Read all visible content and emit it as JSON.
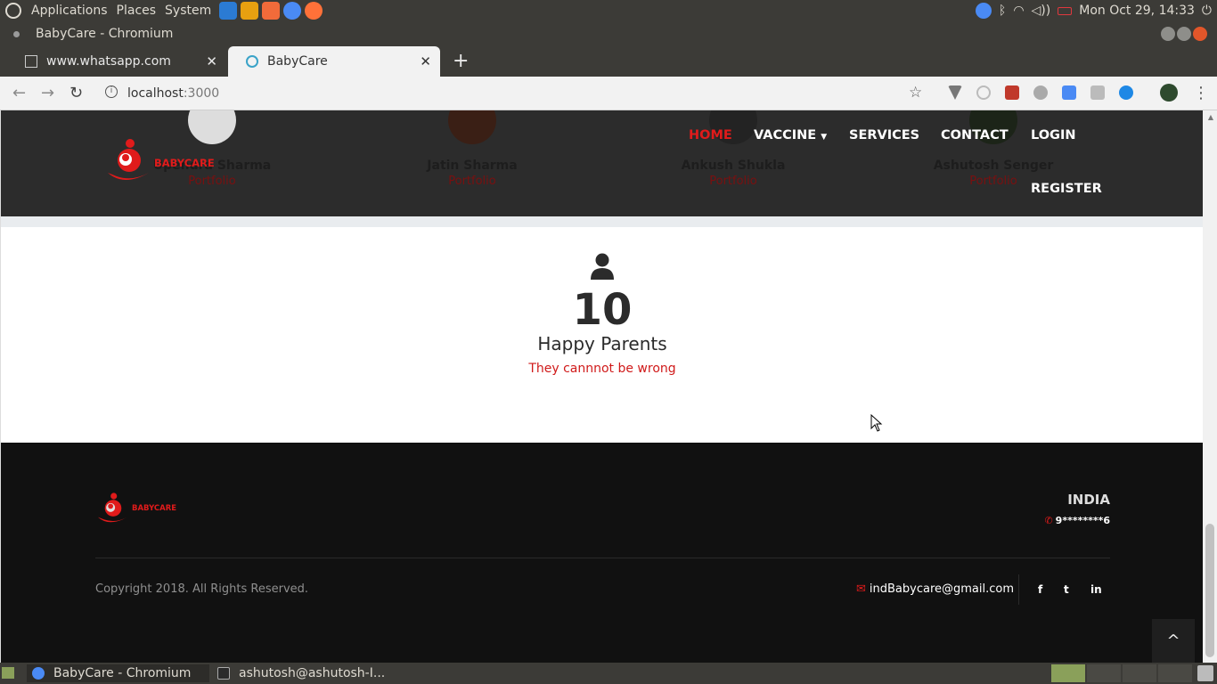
{
  "topbar": {
    "menus": [
      "Applications",
      "Places",
      "System"
    ],
    "clock": "Mon Oct 29, 14:33"
  },
  "window": {
    "title": "BabyCare - Chromium"
  },
  "tabs": [
    {
      "label": "www.whatsapp.com"
    },
    {
      "label": "BabyCare"
    }
  ],
  "omnibox": {
    "host": "localhost",
    "port": ":3000"
  },
  "team": [
    {
      "name": "Upendra Sharma",
      "link": "Portfolio"
    },
    {
      "name": "Jatin Sharma",
      "link": "Portfolio"
    },
    {
      "name": "Ankush Shukla",
      "link": "Portfolio"
    },
    {
      "name": "Ashutosh Senger",
      "link": "Portfolio"
    }
  ],
  "site_nav": {
    "brand": "BABYCARE",
    "home": "HOME",
    "vaccine": "VACCINE",
    "services": "SERVICES",
    "contact": "CONTACT",
    "login": "LOGIN",
    "register": "REGISTER"
  },
  "counter": {
    "value": "10",
    "label": "Happy Parents",
    "tagline": "They cannnot be wrong"
  },
  "footer": {
    "brand": "BABYCARE",
    "country": "INDIA",
    "phone": "9********6",
    "copyright": "Copyright 2018. All Rights Reserved.",
    "email": "indBabycare@gmail.com",
    "social": [
      "f",
      "t",
      "in"
    ],
    "to_top": "^"
  },
  "taskbar": {
    "tasks": [
      "BabyCare - Chromium",
      "ashutosh@ashutosh-I..."
    ]
  },
  "colors": {
    "accent": "#e01b1b",
    "footer_bg": "#111111",
    "band_bg": "#2c2c2c"
  }
}
